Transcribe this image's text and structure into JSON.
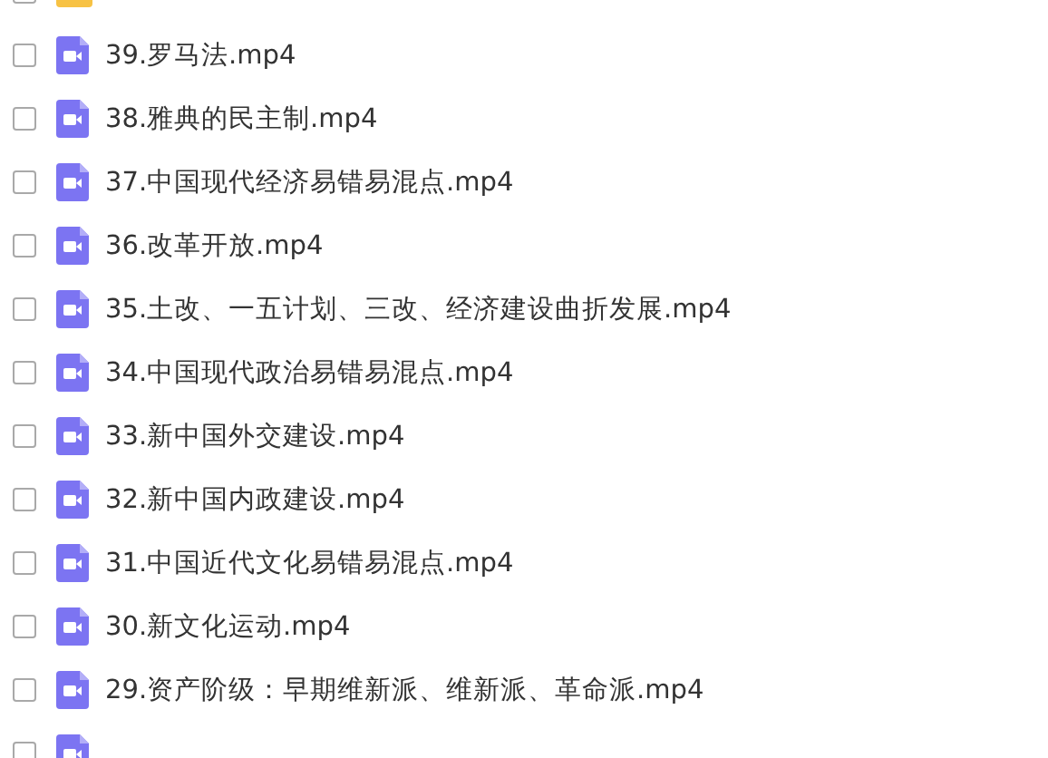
{
  "files": [
    {
      "kind": "folder",
      "checked": false
    },
    {
      "kind": "video",
      "checked": false,
      "name": "39.罗马法.mp4"
    },
    {
      "kind": "video",
      "checked": false,
      "name": "38.雅典的民主制.mp4"
    },
    {
      "kind": "video",
      "checked": false,
      "name": "37.中国现代经济易错易混点.mp4"
    },
    {
      "kind": "video",
      "checked": false,
      "name": "36.改革开放.mp4"
    },
    {
      "kind": "video",
      "checked": false,
      "name": "35.土改、一五计划、三改、经济建设曲折发展.mp4"
    },
    {
      "kind": "video",
      "checked": false,
      "name": "34.中国现代政治易错易混点.mp4"
    },
    {
      "kind": "video",
      "checked": false,
      "name": "33.新中国外交建设.mp4"
    },
    {
      "kind": "video",
      "checked": false,
      "name": "32.新中国内政建设.mp4"
    },
    {
      "kind": "video",
      "checked": false,
      "name": "31.中国近代文化易错易混点.mp4"
    },
    {
      "kind": "video",
      "checked": false,
      "name": "30.新文化运动.mp4"
    },
    {
      "kind": "video",
      "checked": false,
      "name": "29.资产阶级：早期维新派、维新派、革命派.mp4"
    },
    {
      "kind": "video",
      "checked": false
    }
  ]
}
